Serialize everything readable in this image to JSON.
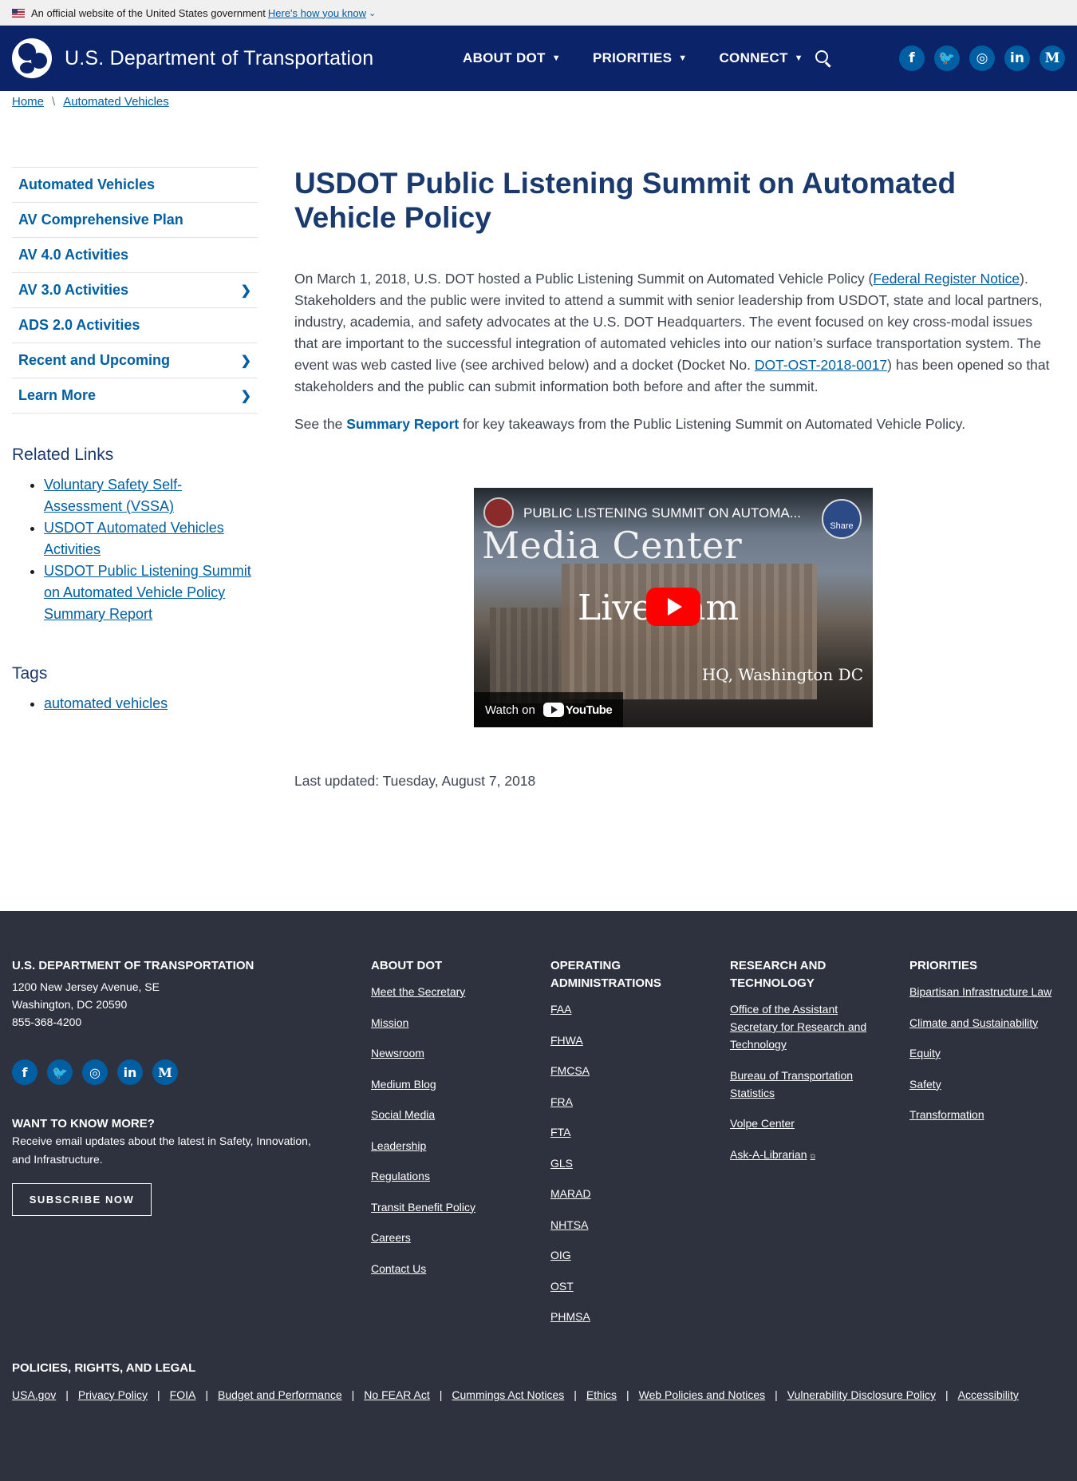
{
  "gov_banner": {
    "text": "An official website of the United States government",
    "link": "Here's how you know",
    "chevron": "⌄"
  },
  "header": {
    "site_title": "U.S. Department of Transportation",
    "nav": [
      {
        "label": "ABOUT DOT"
      },
      {
        "label": "PRIORITIES"
      },
      {
        "label": "CONNECT"
      }
    ],
    "social": [
      {
        "name": "facebook",
        "glyph": "f"
      },
      {
        "name": "twitter",
        "glyph": "🐦"
      },
      {
        "name": "instagram",
        "glyph": "◎"
      },
      {
        "name": "linkedin",
        "glyph": "in"
      },
      {
        "name": "medium",
        "glyph": "M"
      }
    ]
  },
  "breadcrumb": {
    "home": "Home",
    "current": "Automated Vehicles",
    "separator": "\\"
  },
  "sidenav": [
    {
      "label": "Automated Vehicles",
      "has_children": false
    },
    {
      "label": "AV Comprehensive Plan",
      "has_children": false
    },
    {
      "label": "AV 4.0 Activities",
      "has_children": false
    },
    {
      "label": "AV 3.0 Activities",
      "has_children": true
    },
    {
      "label": "ADS 2.0 Activities",
      "has_children": false
    },
    {
      "label": "Recent and Upcoming",
      "has_children": true
    },
    {
      "label": "Learn More",
      "has_children": true
    }
  ],
  "related_links": {
    "heading": "Related Links",
    "items": [
      "Voluntary Safety Self-Assessment (VSSA)",
      "USDOT Automated Vehicles Activities",
      "USDOT Public Listening Summit on Automated Vehicle Policy Summary Report"
    ]
  },
  "tags": {
    "heading": "Tags",
    "items": [
      "automated vehicles"
    ]
  },
  "main": {
    "title": "USDOT Public Listening Summit on Automated Vehicle Policy",
    "intro_1": "On March 1, 2018, U.S. DOT hosted a Public Listening Summit on Automated Vehicle Policy (",
    "intro_link_1": "Federal Register Notice",
    "intro_2": "). Stakeholders and the public were invited to attend a summit with senior leadership from USDOT, state and local partners, industry, academia, and safety advocates at the U.S. DOT Headquarters.  The event focused on key cross-modal issues that are important to the successful integration of automated vehicles into our nation’s surface transportation system. The event was web casted live (see archived below) and a docket (Docket No. ",
    "intro_link_2": "DOT-OST-2018-0017",
    "intro_3": ") has been opened so that stakeholders and the public can submit information both before and after the summit.",
    "summary_pre": "See the ",
    "summary_link": "Summary Report",
    "summary_post": " for key takeaways from the Public Listening Summit on Automated Vehicle Policy.",
    "video": {
      "title": "PUBLIC LISTENING SUMMIT ON AUTOMA...",
      "share": "Share",
      "overlay_line1": "Media Center",
      "overlay_line2": "Live  eam",
      "overlay_line3": "HQ, Washington DC",
      "watch_on": "Watch on",
      "youtube": "YouTube"
    },
    "last_updated": "Last updated: Tuesday, August 7, 2018"
  },
  "footer": {
    "org": {
      "heading": "U.S. DEPARTMENT OF TRANSPORTATION",
      "address_1": "1200 New Jersey Avenue, SE",
      "address_2": "Washington, DC 20590",
      "phone": "855-368-4200"
    },
    "social": [
      {
        "name": "facebook",
        "glyph": "f"
      },
      {
        "name": "twitter",
        "glyph": "🐦"
      },
      {
        "name": "instagram",
        "glyph": "◎"
      },
      {
        "name": "linkedin",
        "glyph": "in"
      },
      {
        "name": "medium",
        "glyph": "M"
      }
    ],
    "want_to_know": {
      "heading": "WANT TO KNOW MORE?",
      "text": "Receive email updates about the latest in Safety, Innovation, and Infrastructure.",
      "button": "SUBSCRIBE NOW"
    },
    "about": {
      "heading": "ABOUT DOT",
      "links": [
        "Meet the Secretary",
        "Mission",
        "Newsroom",
        "Medium Blog",
        "Social Media",
        "Leadership",
        "Regulations",
        "Transit Benefit Policy",
        "Careers",
        "Contact Us"
      ]
    },
    "operating": {
      "heading": "OPERATING ADMINISTRATIONS",
      "links": [
        "FAA",
        "FHWA",
        "FMCSA",
        "FRA",
        "FTA",
        "GLS",
        "MARAD",
        "NHTSA",
        "OIG",
        "OST",
        "PHMSA"
      ]
    },
    "research": {
      "heading": "RESEARCH AND TECHNOLOGY",
      "links": [
        "Office of the Assistant Secretary for Research and Technology",
        "Bureau of Transportation Statistics",
        "Volpe Center",
        "Ask-A-Librarian"
      ]
    },
    "priorities": {
      "heading": "PRIORITIES",
      "links": [
        "Bipartisan Infrastructure Law",
        "Climate and Sustainability",
        "Equity",
        "Safety",
        "Transformation"
      ]
    },
    "policies": {
      "heading": "POLICIES, RIGHTS, AND LEGAL",
      "links": [
        "USA.gov",
        "Privacy Policy",
        "FOIA",
        "Budget and Performance",
        "No FEAR Act",
        "Cummings Act Notices",
        "Ethics",
        "Web Policies and Notices",
        "Vulnerability Disclosure Policy",
        "Accessibility"
      ]
    }
  }
}
